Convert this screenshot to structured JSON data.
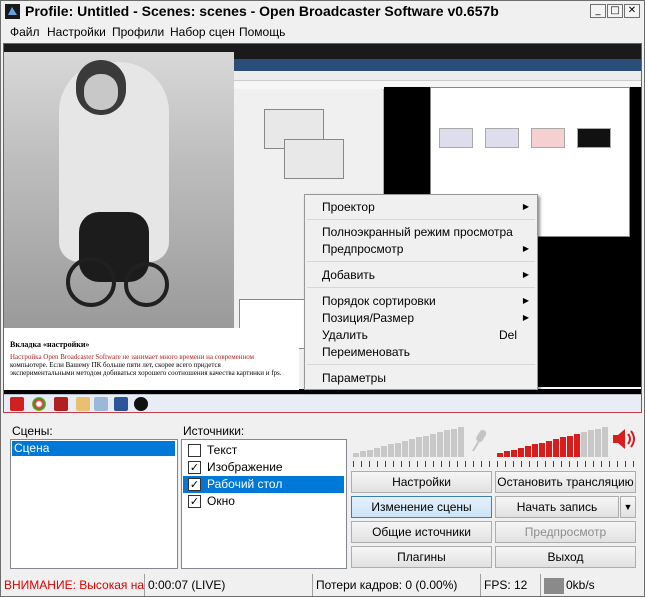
{
  "window": {
    "title": "Profile: Untitled - Scenes: scenes - Open Broadcaster Software v0.657b",
    "minimize": "_",
    "maximize": "□",
    "close": "✕"
  },
  "menu": [
    "Файл",
    "Настройки",
    "Профили",
    "Набор сцен",
    "Помощь"
  ],
  "preview": {
    "article_heading": "Вкладка «настройки»",
    "article_line1": "Настройка Open Broadcaster Software не занимает много времени на современном",
    "article_line2": "компьютере. Если Вашему ПК больше пяти лет, скорее всего придется",
    "article_line3": "экспериментальными методом добиваться хорошего соотношения качества картинки и fps."
  },
  "context_menu": {
    "items": [
      {
        "label": "Проектор",
        "submenu": true
      },
      {
        "label": "Полноэкранный режим просмотра",
        "submenu": false
      },
      {
        "label": "Предпросмотр",
        "submenu": true
      },
      {
        "label": "Добавить",
        "submenu": true
      },
      {
        "label": "Порядок сортировки",
        "submenu": true
      },
      {
        "label": "Позиция/Размер",
        "submenu": true
      },
      {
        "label": "Удалить",
        "submenu": false,
        "shortcut": "Del"
      },
      {
        "label": "Переименовать",
        "submenu": false
      },
      {
        "label": "Параметры",
        "submenu": false
      }
    ],
    "arrow": "▶"
  },
  "scenes": {
    "label": "Сцены:",
    "items": [
      "Сцена"
    ]
  },
  "sources": {
    "label": "Источники:",
    "items": [
      {
        "name": "Текст",
        "checked": false,
        "selected": false
      },
      {
        "name": "Изображение",
        "checked": true,
        "selected": false
      },
      {
        "name": "Рабочий стол",
        "checked": true,
        "selected": true
      },
      {
        "name": "Окно",
        "checked": true,
        "selected": false
      }
    ],
    "check_mark": "✓"
  },
  "buttons": {
    "settings": "Настройки",
    "stop_stream": "Остановить трансляцию",
    "edit_scene": "Изменение сцены",
    "start_record": "Начать запись",
    "record_dropdown": "▼",
    "global_sources": "Общие источники",
    "preview": "Предпросмотр",
    "plugins": "Плагины",
    "exit": "Выход"
  },
  "audio": {
    "mic_level": 0.0,
    "desktop_level": 0.75,
    "mic_color": "#c8c8c8",
    "desktop_color": "#d91c1c"
  },
  "status": {
    "warning": "ВНИМАНИЕ: Высокая нагр",
    "time": "0:00:07 (LIVE)",
    "dropped": "Потери кадров: 0 (0.00%)",
    "fps": "FPS: 12",
    "bitrate": "0kb/s"
  },
  "colors": {
    "accent": "#0078d7",
    "warning": "#e00000",
    "preview_border": "#c0404a"
  }
}
